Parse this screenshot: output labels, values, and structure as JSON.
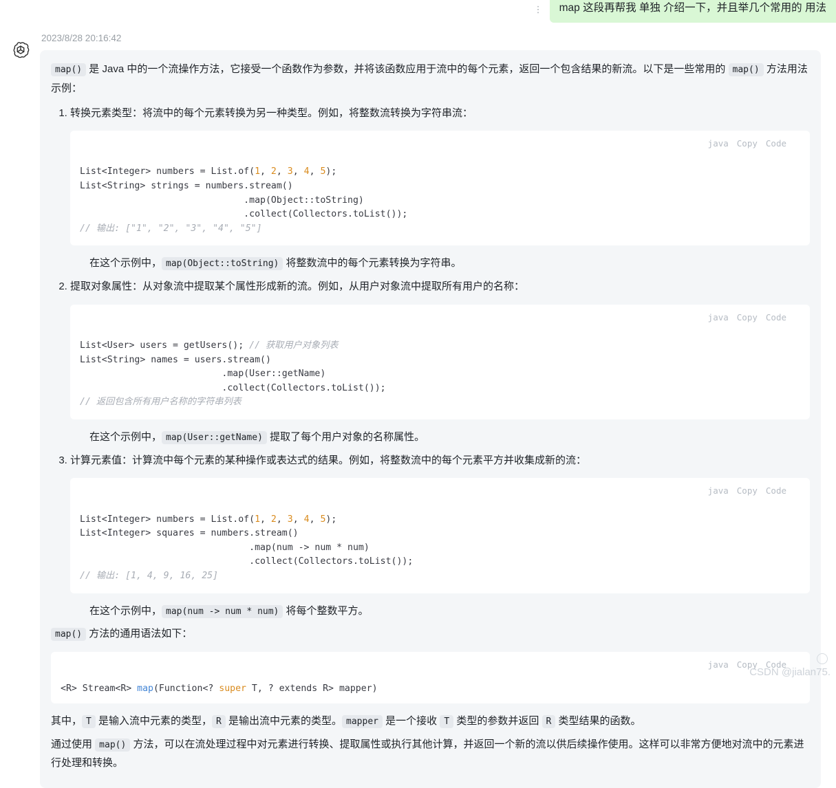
{
  "user_message": {
    "text": "map 这段再帮我 单独 介绍一下，并且举几个常用的 用法",
    "handle": "⋮"
  },
  "assistant": {
    "timestamp": "2023/8/28 20:16:42",
    "avatar_icon": "openai-logo-icon",
    "intro": {
      "code": "map()",
      "before": "",
      "mid": " 是 Java 中的一个流操作方法，它接受一个函数作为参数，并将该函数应用于流中的每个元素，返回一个包含结果的新流。以下是一些常用的 ",
      "code2": "map()",
      "after": " 方法用法示例："
    },
    "steps": [
      "转换元素类型：将流中的每个元素转换为另一种类型。例如，将整数流转换为字符串流：",
      "提取对象属性：从对象流中提取某个属性形成新的流。例如，从用户对象流中提取所有用户的名称：",
      "计算元素值：计算流中每个元素的某种操作或表达式的结果。例如，将整数流中的每个元素平方并收集成新的流："
    ],
    "code_blocks": [
      {
        "lang": "java",
        "copy_label": "Copy",
        "code_label": "Code",
        "lines": [
          "List<Integer> numbers = List.of(1, 2, 3, 4, 5);",
          "List<String> strings = numbers.stream()",
          "                              .map(Object::toString)",
          "                              .collect(Collectors.toList());",
          "// 输出: [\"1\", \"2\", \"3\", \"4\", \"5\"]"
        ]
      },
      {
        "lang": "java",
        "copy_label": "Copy",
        "code_label": "Code",
        "lines": [
          "List<User> users = getUsers(); // 获取用户对象列表",
          "List<String> names = users.stream()",
          "                          .map(User::getName)",
          "                          .collect(Collectors.toList());",
          "// 返回包含所有用户名称的字符串列表"
        ]
      },
      {
        "lang": "java",
        "copy_label": "Copy",
        "code_label": "Code",
        "lines": [
          "List<Integer> numbers = List.of(1, 2, 3, 4, 5);",
          "List<Integer> squares = numbers.stream()",
          "                               .map(num -> num * num)",
          "                               .collect(Collectors.toList());",
          "// 输出: [1, 4, 9, 16, 25]"
        ]
      },
      {
        "lang": "java",
        "copy_label": "Copy",
        "code_label": "Code",
        "lines": [
          "<R> Stream<R> map(Function<? super T, ? extends R> mapper)"
        ]
      }
    ],
    "explanations": [
      {
        "prefix": "在这个示例中，",
        "code": "map(Object::toString)",
        "suffix": " 将整数流中的每个元素转换为字符串。"
      },
      {
        "prefix": "在这个示例中，",
        "code": "map(User::getName)",
        "suffix": " 提取了每个用户对象的名称属性。"
      },
      {
        "prefix": "在这个示例中，",
        "code": "map(num -> num * num)",
        "suffix": " 将每个整数平方。"
      }
    ],
    "syntax_intro": {
      "code": "map()",
      "suffix": " 方法的通用语法如下："
    },
    "closing": {
      "line1_a": "其中，",
      "line1_t": "T",
      "line1_b": " 是输入流中元素的类型，",
      "line1_r": "R",
      "line1_c": " 是输出流中元素的类型。",
      "line1_mapper": "mapper",
      "line1_d": " 是一个接收 ",
      "line1_t2": "T",
      "line1_e": " 类型的参数并返回 ",
      "line1_r2": "R",
      "line1_f": " 类型结果的函数。",
      "line2_a": "通过使用 ",
      "line2_code": "map()",
      "line2_b": " 方法，可以在流处理过程中对元素进行转换、提取属性或执行其他计算，并返回一个新的流以供后续操作使用。这样可以非常方便地对流中的元素进行处理和转换。"
    }
  },
  "watermark": {
    "text": "CSDN @jialan75.",
    "icon": "circle-icon"
  },
  "colors": {
    "user_bubble": "#d9f7d5",
    "assistant_bubble": "#f4f6f8",
    "code_bg": "#ffffff",
    "accent_number": "#d98b1e",
    "accent_fn": "#4285d6",
    "comment": "#a8adb5",
    "muted": "#9aa0a6"
  }
}
